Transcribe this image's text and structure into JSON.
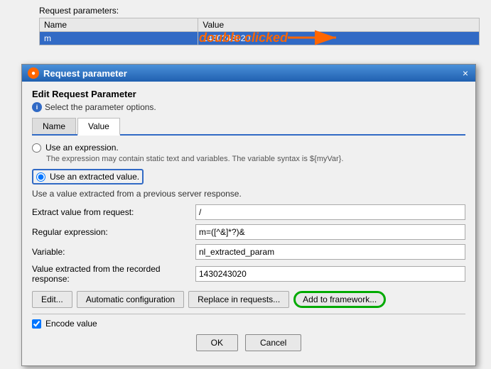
{
  "background": {
    "request_params_label": "Request parameters:",
    "table": {
      "headers": [
        "Name",
        "Value"
      ],
      "rows": [
        {
          "name": "m",
          "value": "1430243020",
          "selected": true
        }
      ]
    }
  },
  "annotation": {
    "text": "double clicked",
    "arrow": "→"
  },
  "modal": {
    "title": "Request parameter",
    "close_label": "×",
    "section_title": "Edit Request Parameter",
    "section_hint": "Select the parameter options.",
    "tabs": [
      {
        "label": "Name",
        "active": false
      },
      {
        "label": "Value",
        "active": true
      }
    ],
    "radio_expression": {
      "label": "Use an expression.",
      "description": "The expression may contain static text and variables. The variable syntax is ${myVar}."
    },
    "radio_extracted": {
      "label": "Use an extracted value.",
      "description": "Use a value extracted from a previous server response."
    },
    "form_rows": [
      {
        "label": "Extract value from request:",
        "value": "/"
      },
      {
        "label": "Regular expression:",
        "value": "m=([^&]*?)&"
      },
      {
        "label": "Variable:",
        "value": "nl_extracted_param"
      },
      {
        "label": "Value extracted from the recorded response:",
        "value": "1430243020"
      }
    ],
    "buttons": [
      {
        "label": "Edit..."
      },
      {
        "label": "Automatic configuration"
      },
      {
        "label": "Replace in requests..."
      },
      {
        "label": "Add to framework..."
      }
    ],
    "checkbox": {
      "label": "Encode value",
      "checked": true
    },
    "bottom_buttons": [
      {
        "label": "OK"
      },
      {
        "label": "Cancel"
      }
    ]
  },
  "sidebar": {
    "arrows": [
      "▲",
      "▼",
      "◄",
      "►"
    ]
  }
}
